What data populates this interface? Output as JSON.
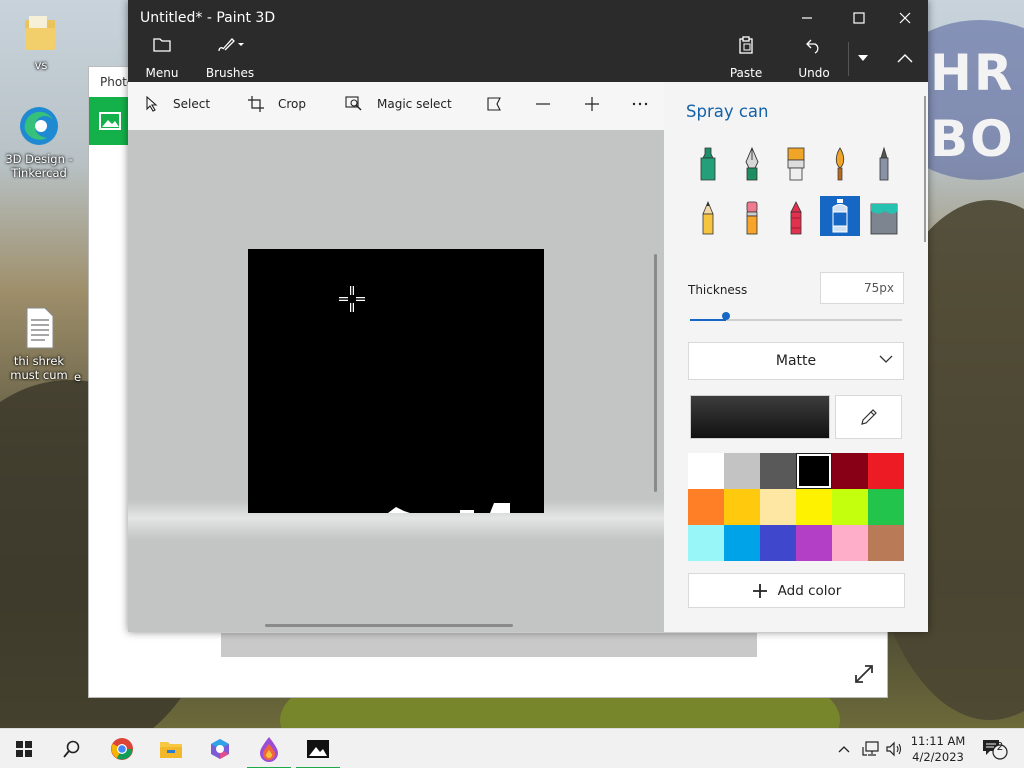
{
  "desktop": {
    "icons": [
      {
        "label": "vs"
      },
      {
        "label": "3D Design - Tinkercad"
      },
      {
        "label": "thi shrek must cum"
      },
      {
        "label": "e"
      }
    ],
    "bg_text": {
      "line1": "HR",
      "line2": "BO"
    }
  },
  "photos_window": {
    "title": "Photo"
  },
  "paint3d": {
    "title": "Untitled* - Paint 3D",
    "toolbar": {
      "menu_label": "Menu",
      "brushes_label": "Brushes",
      "paste_label": "Paste",
      "undo_label": "Undo"
    },
    "tools": {
      "select_label": "Select",
      "crop_label": "Crop",
      "magic_select_label": "Magic select"
    },
    "panel": {
      "title": "Spray can",
      "brushes": [
        {
          "name": "marker-icon",
          "selected": false
        },
        {
          "name": "calligraphy-pen-icon",
          "selected": false
        },
        {
          "name": "oil-brush-icon",
          "selected": false
        },
        {
          "name": "watercolor-icon",
          "selected": false
        },
        {
          "name": "pixel-pen-icon",
          "selected": false
        },
        {
          "name": "pencil-icon",
          "selected": false
        },
        {
          "name": "eraser-icon",
          "selected": false
        },
        {
          "name": "crayon-icon",
          "selected": false
        },
        {
          "name": "spray-can-icon",
          "selected": true
        },
        {
          "name": "fill-bucket-icon",
          "selected": false
        }
      ],
      "thickness_label": "Thickness",
      "thickness_value": "75px",
      "thickness_fraction": 0.17,
      "finish_value": "Matte",
      "current_color": "#000000",
      "palette": [
        "#ffffff",
        "#c3c3c3",
        "#595959",
        "#000000",
        "#880015",
        "#ed1c24",
        "#ff7f27",
        "#ffc90e",
        "#fde7a2",
        "#fff200",
        "#c4ff0e",
        "#22c44b",
        "#99f6f8",
        "#00a2e8",
        "#3f48cc",
        "#b33fc7",
        "#ffaec9",
        "#b97a57"
      ],
      "selected_swatch": 3,
      "add_color_label": "Add color"
    }
  },
  "taskbar": {
    "time": "11:11 AM",
    "date": "4/2/2023",
    "notification_count": "2"
  },
  "colors": {
    "accent": "#1667c4",
    "title_bar": "#2b2b2b",
    "taskbar_active": "#1da84a"
  }
}
